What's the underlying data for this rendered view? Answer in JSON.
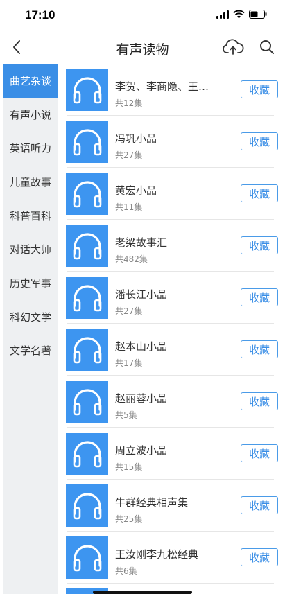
{
  "status": {
    "time": "17:10"
  },
  "nav": {
    "title": "有声读物"
  },
  "sidebar": {
    "items": [
      {
        "label": "曲艺杂谈",
        "active": true
      },
      {
        "label": "有声小说"
      },
      {
        "label": "英语听力"
      },
      {
        "label": "儿童故事"
      },
      {
        "label": "科普百科"
      },
      {
        "label": "对话大师"
      },
      {
        "label": "历史军事"
      },
      {
        "label": "科幻文学"
      },
      {
        "label": "文学名著"
      }
    ]
  },
  "list": {
    "fav_label": "收藏",
    "items": [
      {
        "title": "李贺、李商隐、王…",
        "count": "共12集"
      },
      {
        "title": "冯巩小品",
        "count": "共27集"
      },
      {
        "title": "黄宏小品",
        "count": "共11集"
      },
      {
        "title": "老梁故事汇",
        "count": "共482集"
      },
      {
        "title": "潘长江小品",
        "count": "共27集"
      },
      {
        "title": "赵本山小品",
        "count": "共17集"
      },
      {
        "title": "赵丽蓉小品",
        "count": "共5集"
      },
      {
        "title": "周立波小品",
        "count": "共15集"
      },
      {
        "title": "牛群经典相声集",
        "count": "共25集"
      },
      {
        "title": "王汝刚李九松经典",
        "count": "共6集"
      }
    ]
  },
  "colors": {
    "accent": "#3a8ee6",
    "thumb": "#3d95f0",
    "sidebar_bg": "#eef0f2"
  }
}
